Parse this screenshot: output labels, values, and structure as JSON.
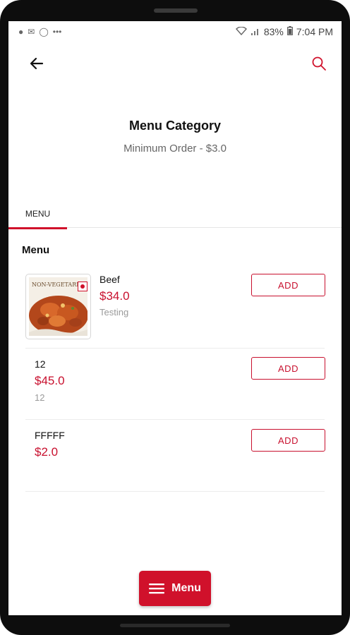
{
  "status_bar": {
    "left_icons": [
      "tinder-icon",
      "gmail-icon",
      "sync-icon",
      "more-dots-icon"
    ],
    "battery": "83%",
    "time": "7:04 PM"
  },
  "header": {
    "back_icon": "arrow-left-icon",
    "search_icon": "search-icon",
    "title": "Menu Category",
    "subtitle": "Minimum Order - $3.0"
  },
  "tabs": [
    {
      "label": "MENU",
      "active": true
    }
  ],
  "section": {
    "title": "Menu"
  },
  "items": [
    {
      "name": "Beef",
      "price": "$34.0",
      "description": "Testing",
      "has_image": true,
      "image_caption": "NON-VEGETARIAN",
      "button": "ADD"
    },
    {
      "name": "12",
      "price": "$45.0",
      "description": "12",
      "has_image": false,
      "button": "ADD"
    },
    {
      "name": "FFFFF",
      "price": "$2.0",
      "description": "",
      "has_image": false,
      "button": "ADD"
    }
  ],
  "floating_button": {
    "label": "Menu",
    "icon": "hamburger-icon"
  },
  "colors": {
    "accent": "#d0112b",
    "price": "#c8102e",
    "muted": "#9a9a9a"
  }
}
